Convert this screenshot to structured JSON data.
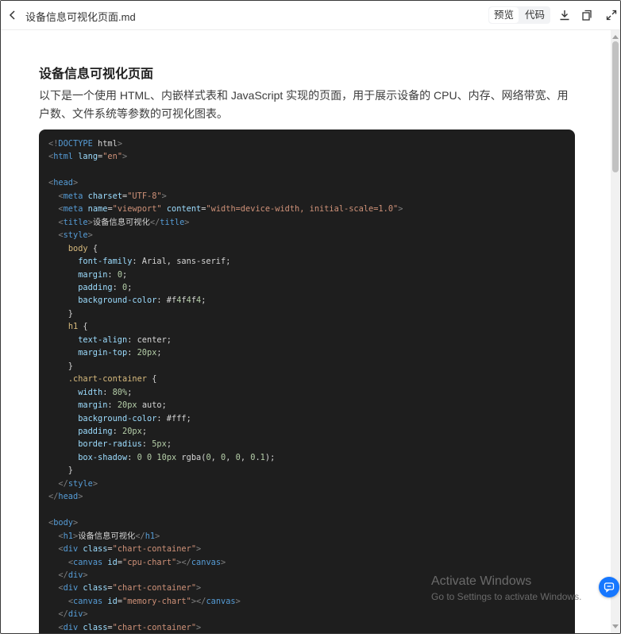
{
  "header": {
    "back_icon": "chevron-left-icon",
    "file_name": "设备信息可视化页面.md",
    "tabs": [
      {
        "label": "预览",
        "active": true
      },
      {
        "label": "代码",
        "active": false
      }
    ],
    "tools": [
      "download-icon",
      "copy-icon",
      "expand-icon"
    ]
  },
  "doc": {
    "title": "设备信息可视化页面",
    "intro": "以下是一个使用 HTML、内嵌样式表和 JavaScript 实现的页面，用于展示设备的 CPU、内存、网络带宽、用户数、文件系统等参数的可视化图表。"
  },
  "code": {
    "language": "html",
    "lines": [
      "<!DOCTYPE html>",
      "<html lang=\"en\">",
      "",
      "<head>",
      "  <meta charset=\"UTF-8\">",
      "  <meta name=\"viewport\" content=\"width=device-width, initial-scale=1.0\">",
      "  <title>设备信息可视化</title>",
      "  <style>",
      "    body {",
      "      font-family: Arial, sans-serif;",
      "      margin: 0;",
      "      padding: 0;",
      "      background-color: #f4f4f4;",
      "    }",
      "    h1 {",
      "      text-align: center;",
      "      margin-top: 20px;",
      "    }",
      "    .chart-container {",
      "      width: 80%;",
      "      margin: 20px auto;",
      "      background-color: #fff;",
      "      padding: 20px;",
      "      border-radius: 5px;",
      "      box-shadow: 0 0 10px rgba(0, 0, 0, 0.1);",
      "    }",
      "  </style>",
      "</head>",
      "",
      "<body>",
      "  <h1>设备信息可视化</h1>",
      "  <div class=\"chart-container\">",
      "    <canvas id=\"cpu-chart\"></canvas>",
      "  </div>",
      "  <div class=\"chart-container\">",
      "    <canvas id=\"memory-chart\"></canvas>",
      "  </div>",
      "  <div class=\"chart-container\">"
    ]
  },
  "watermark": {
    "title": "Activate Windows",
    "subtitle": "Go to Settings to activate Windows."
  },
  "fab_icon": "chat-icon",
  "colors": {
    "code_bg": "#1e1e1e",
    "accent": "#1677ff"
  }
}
